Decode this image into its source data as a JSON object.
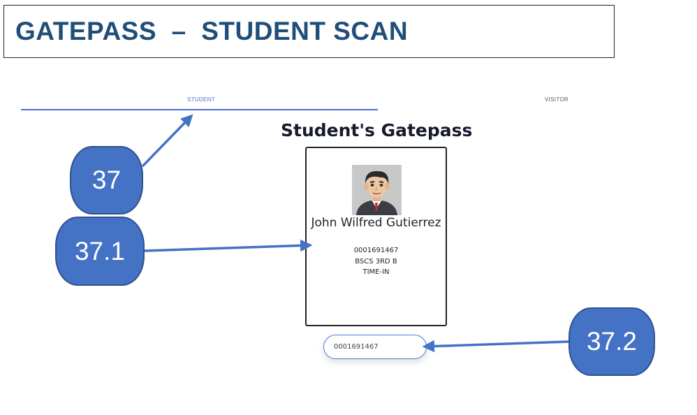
{
  "header": {
    "title": "GATEPASS  –  STUDENT SCAN"
  },
  "tabs": [
    {
      "label": "STUDENT",
      "active": true
    },
    {
      "label": "VISITOR",
      "active": false
    }
  ],
  "page_heading": "Student's Gatepass",
  "student_card": {
    "name": "John Wilfred Gutierrez",
    "student_id": "0001691467",
    "course": "BSCS 3RD B",
    "status": "TIME-IN",
    "avatar_icon": "user-avatar-icon"
  },
  "scan_input": {
    "value": "0001691467"
  },
  "annotations": [
    {
      "label": "37"
    },
    {
      "label": "37.1"
    },
    {
      "label": "37.2"
    }
  ],
  "colors": {
    "title": "#1f4e79",
    "accent": "#4a6fd8",
    "callout_fill": "#4472c4",
    "callout_border": "#2f528f",
    "arrow": "#4472c4"
  }
}
